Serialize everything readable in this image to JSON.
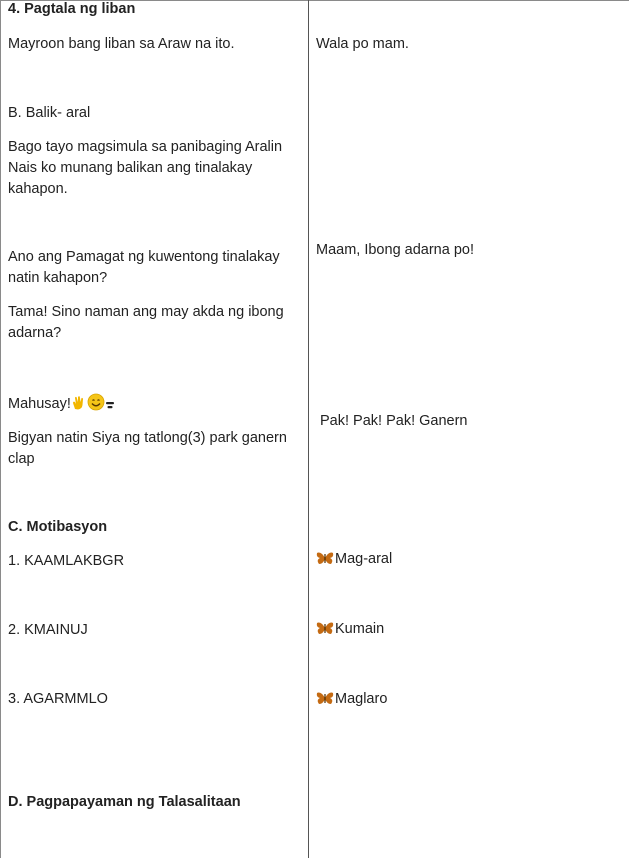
{
  "left": {
    "sec4_title": "4. Pagtala ng liban",
    "absent_question": "Mayroon bang liban sa Araw na ito.",
    "secB_title": "B. Balik- aral",
    "review_line1": "Bago tayo magsimula sa panibaging Aralin",
    "review_line2": "Nais ko munang balikan ang tinalakay",
    "review_line3": "kahapon.",
    "title_q_line1": " Ano ang Pamagat ng kuwentong tinalakay",
    "title_q_line2": "natin kahapon?",
    "author_q_line1": "Tama! Sino naman ang may akda ng ibong",
    "author_q_line2": "adarna?",
    "praise": "Mahusay!",
    "clap_line1": "Bigyan natin Siya ng tatlong(3) park ganern",
    "clap_line2": "clap",
    "secC_title": "C. Motibasyon",
    "item1": " 1. KAAMLAKBGR",
    "item2": "2. KMAINUJ",
    "item3": "3. AGARMMLO",
    "secD_title": "D. Pagpapayaman ng Talasalitaan"
  },
  "right": {
    "absent_answer": "Wala po mam.",
    "title_answer": "Maam, Ibong adarna po!",
    "clap_answer": "Pak! Pak! Pak! Ganern",
    "answer1": "Mag-aral",
    "answer2": "Kumain",
    "answer3": "Maglaro"
  },
  "icons": {
    "praise_emojis": [
      "clapping-hands",
      "smiling-face",
      "dark-mark"
    ],
    "answer_icon": "butterfly"
  },
  "colors": {
    "text": "#222222",
    "divider": "#555555",
    "butterfly": "#c46a12",
    "clap": "#f2b600",
    "smile": "#f5c518"
  }
}
